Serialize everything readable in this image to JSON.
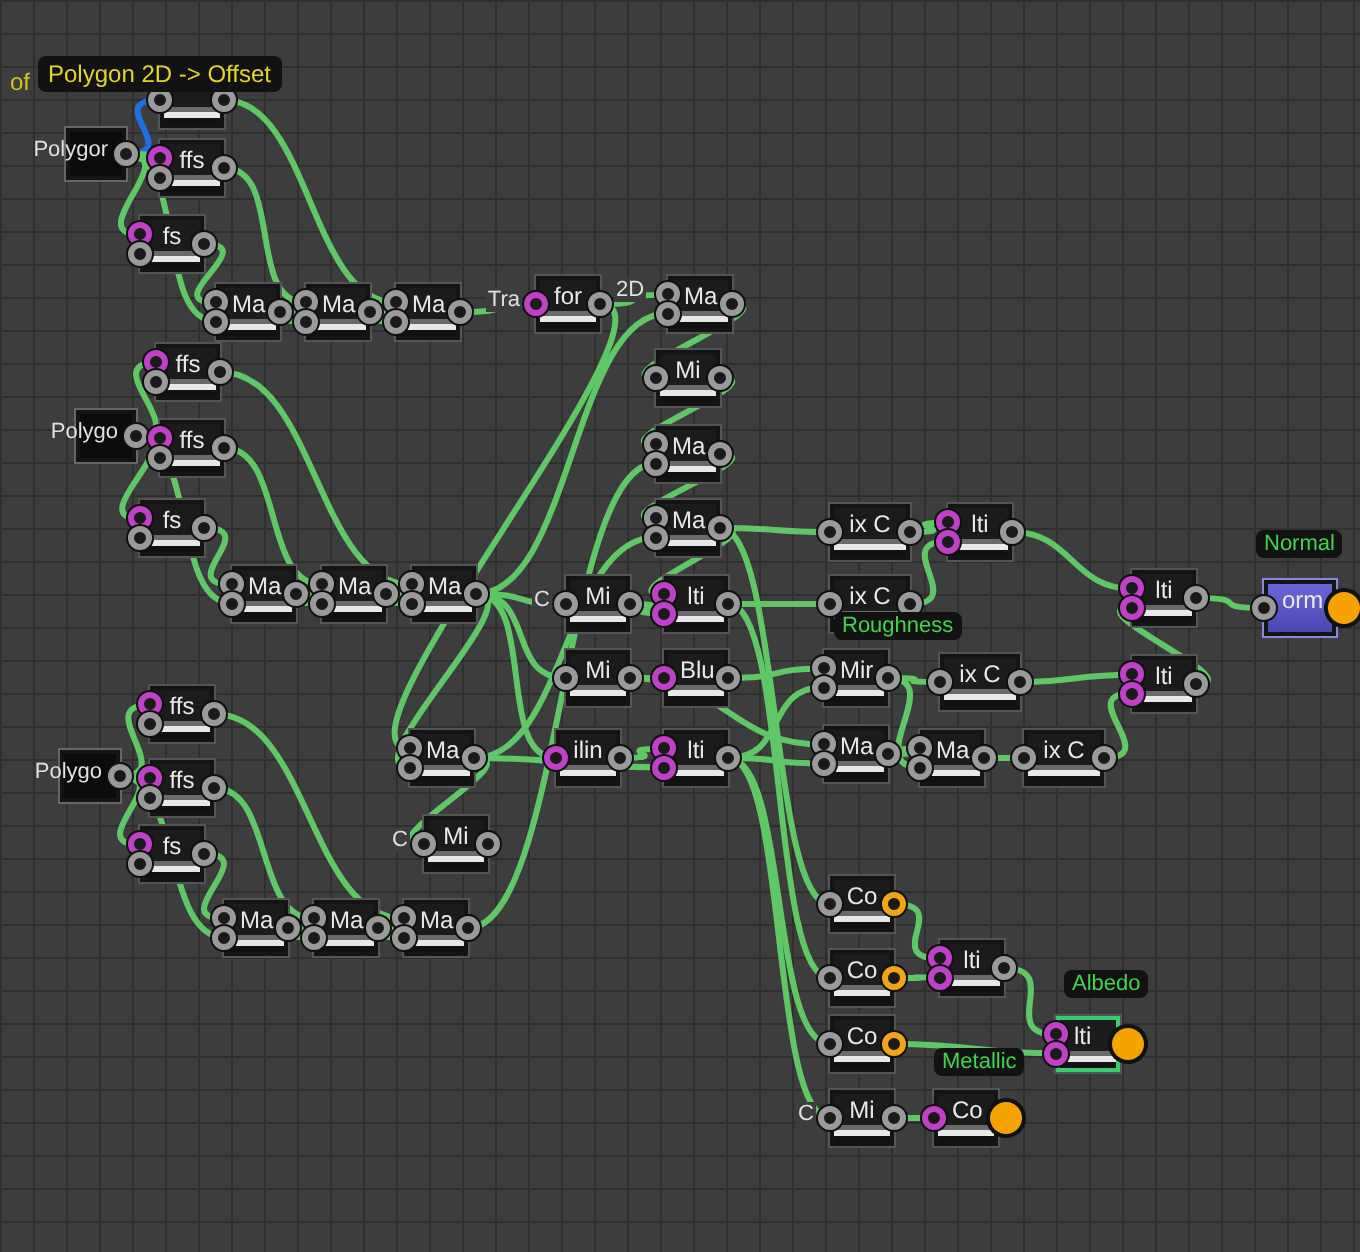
{
  "canvas": {
    "overlay_text": "of",
    "tooltip": "Polygon 2D -> Offset",
    "nodes": [
      {
        "kind": "node",
        "selected": false,
        "inputs": [
          {
            "color": "#9a9a9a"
          }
        ]
      },
      {
        "kind": "source",
        "label": "Polygor",
        "selected": false
      },
      {
        "kind": "node",
        "label": "ffs",
        "selected": false,
        "inputs": [
          {
            "color": "#c040c8"
          },
          {
            "color": "#9a9a9a"
          }
        ]
      },
      {
        "kind": "node",
        "label": "fs",
        "selected": false,
        "inputs": [
          {
            "color": "#c040c8"
          },
          {
            "color": "#9a9a9a"
          }
        ]
      },
      {
        "kind": "node",
        "label": "Ma",
        "selected": false,
        "inputs": [
          {
            "color": "#9a9a9a"
          },
          {
            "color": "#9a9a9a"
          }
        ]
      },
      {
        "kind": "node",
        "label": "Ma",
        "selected": false,
        "inputs": [
          {
            "color": "#9a9a9a"
          },
          {
            "color": "#9a9a9a"
          }
        ]
      },
      {
        "kind": "node",
        "label": "Ma",
        "selected": false,
        "inputs": [
          {
            "color": "#9a9a9a"
          },
          {
            "color": "#9a9a9a"
          }
        ]
      },
      {
        "kind": "node",
        "label": "for",
        "head": "Tra",
        "tail": "2D",
        "selected": false,
        "inputs": [
          {
            "color": "#c040c8"
          }
        ]
      },
      {
        "kind": "node",
        "label": "Ma",
        "selected": false,
        "inputs": [
          {
            "color": "#9a9a9a"
          },
          {
            "color": "#9a9a9a"
          }
        ]
      },
      {
        "kind": "node",
        "label": "Mi",
        "selected": false,
        "inputs": [
          {
            "color": "#9a9a9a"
          }
        ]
      },
      {
        "kind": "node",
        "label": "Ma",
        "selected": false,
        "inputs": [
          {
            "color": "#9a9a9a"
          },
          {
            "color": "#9a9a9a"
          }
        ]
      },
      {
        "kind": "node",
        "label": "Ma",
        "selected": false,
        "inputs": [
          {
            "color": "#9a9a9a"
          },
          {
            "color": "#9a9a9a"
          }
        ]
      },
      {
        "kind": "node",
        "label": "Mi",
        "head": "C",
        "selected": false,
        "inputs": [
          {
            "color": "#9a9a9a"
          }
        ]
      },
      {
        "kind": "node",
        "label": "lti",
        "selected": false,
        "inputs": [
          {
            "color": "#c040c8"
          },
          {
            "color": "#c040c8"
          }
        ]
      },
      {
        "kind": "node",
        "label": "Mi",
        "selected": false,
        "inputs": [
          {
            "color": "#9a9a9a"
          }
        ]
      },
      {
        "kind": "node",
        "label": "Blu",
        "selected": false,
        "inputs": [
          {
            "color": "#c040c8"
          }
        ]
      },
      {
        "kind": "node",
        "label": "ilin",
        "selected": false,
        "inputs": [
          {
            "color": "#c040c8"
          }
        ]
      },
      {
        "kind": "node",
        "label": "lti",
        "selected": false,
        "inputs": [
          {
            "color": "#c040c8"
          },
          {
            "color": "#c040c8"
          }
        ]
      },
      {
        "kind": "source",
        "label": "Polygo",
        "selected": false
      },
      {
        "kind": "node",
        "label": "ffs",
        "selected": false,
        "inputs": [
          {
            "color": "#c040c8"
          },
          {
            "color": "#9a9a9a"
          }
        ]
      },
      {
        "kind": "node",
        "label": "ffs",
        "selected": false,
        "inputs": [
          {
            "color": "#c040c8"
          },
          {
            "color": "#9a9a9a"
          }
        ]
      },
      {
        "kind": "node",
        "label": "fs",
        "selected": false,
        "inputs": [
          {
            "color": "#c040c8"
          },
          {
            "color": "#9a9a9a"
          }
        ]
      },
      {
        "kind": "node",
        "label": "Ma",
        "selected": false,
        "inputs": [
          {
            "color": "#9a9a9a"
          },
          {
            "color": "#9a9a9a"
          }
        ]
      },
      {
        "kind": "node",
        "label": "Ma",
        "selected": false,
        "inputs": [
          {
            "color": "#9a9a9a"
          },
          {
            "color": "#9a9a9a"
          }
        ]
      },
      {
        "kind": "node",
        "label": "Ma",
        "selected": false,
        "inputs": [
          {
            "color": "#9a9a9a"
          },
          {
            "color": "#9a9a9a"
          }
        ]
      },
      {
        "kind": "node",
        "label": "Ma",
        "selected": false,
        "inputs": [
          {
            "color": "#9a9a9a"
          },
          {
            "color": "#9a9a9a"
          }
        ]
      },
      {
        "kind": "node",
        "label": "Mi",
        "head": "C",
        "selected": false,
        "inputs": [
          {
            "color": "#9a9a9a"
          }
        ]
      },
      {
        "kind": "source",
        "label": "Polygo",
        "selected": false
      },
      {
        "kind": "node",
        "label": "ffs",
        "selected": false,
        "inputs": [
          {
            "color": "#c040c8"
          },
          {
            "color": "#9a9a9a"
          }
        ]
      },
      {
        "kind": "node",
        "label": "ffs",
        "selected": false,
        "inputs": [
          {
            "color": "#c040c8"
          },
          {
            "color": "#9a9a9a"
          }
        ]
      },
      {
        "kind": "node",
        "label": "fs",
        "selected": false,
        "inputs": [
          {
            "color": "#c040c8"
          },
          {
            "color": "#9a9a9a"
          }
        ]
      },
      {
        "kind": "node",
        "label": "Ma",
        "selected": false,
        "inputs": [
          {
            "color": "#9a9a9a"
          },
          {
            "color": "#9a9a9a"
          }
        ]
      },
      {
        "kind": "node",
        "label": "Ma",
        "selected": false,
        "inputs": [
          {
            "color": "#9a9a9a"
          },
          {
            "color": "#9a9a9a"
          }
        ]
      },
      {
        "kind": "node",
        "label": "Ma",
        "selected": false,
        "inputs": [
          {
            "color": "#9a9a9a"
          },
          {
            "color": "#9a9a9a"
          }
        ]
      },
      {
        "kind": "node",
        "label": "ix C",
        "selected": false,
        "inputs": [
          {
            "color": "#9a9a9a"
          }
        ]
      },
      {
        "kind": "node",
        "label": "lti",
        "selected": false,
        "inputs": [
          {
            "color": "#c040c8"
          },
          {
            "color": "#c040c8"
          }
        ]
      },
      {
        "kind": "node",
        "label": "ix C",
        "tag": "Roughness",
        "selected": false,
        "inputs": [
          {
            "color": "#9a9a9a"
          }
        ]
      },
      {
        "kind": "node",
        "label": "Mir",
        "selected": false,
        "inputs": [
          {
            "color": "#9a9a9a"
          },
          {
            "color": "#9a9a9a"
          }
        ]
      },
      {
        "kind": "node",
        "label": "ix C",
        "selected": false,
        "inputs": [
          {
            "color": "#9a9a9a"
          }
        ]
      },
      {
        "kind": "node",
        "label": "Ma",
        "selected": false,
        "inputs": [
          {
            "color": "#9a9a9a"
          },
          {
            "color": "#9a9a9a"
          }
        ]
      },
      {
        "kind": "node",
        "label": "Ma",
        "selected": false,
        "inputs": [
          {
            "color": "#9a9a9a"
          },
          {
            "color": "#9a9a9a"
          }
        ]
      },
      {
        "kind": "node",
        "label": "ix C",
        "selected": false,
        "inputs": [
          {
            "color": "#9a9a9a"
          }
        ]
      },
      {
        "kind": "node",
        "label": "lti",
        "selected": false,
        "inputs": [
          {
            "color": "#c040c8"
          },
          {
            "color": "#c040c8"
          }
        ]
      },
      {
        "kind": "node",
        "label": "lti",
        "selected": false,
        "inputs": [
          {
            "color": "#c040c8"
          },
          {
            "color": "#c040c8"
          }
        ]
      },
      {
        "kind": "normal-output",
        "label": "orm",
        "tag": "Normal",
        "selected": false,
        "inputs": [
          {
            "color": "#9a9a9a"
          }
        ]
      },
      {
        "kind": "color-node",
        "label": "Co",
        "selected": false,
        "inputs": [
          {
            "color": "#9a9a9a"
          }
        ]
      },
      {
        "kind": "color-node",
        "label": "Co",
        "selected": false,
        "inputs": [
          {
            "color": "#9a9a9a"
          }
        ]
      },
      {
        "kind": "node",
        "label": "lti",
        "selected": false,
        "inputs": [
          {
            "color": "#c040c8"
          },
          {
            "color": "#c040c8"
          }
        ]
      },
      {
        "kind": "color-node",
        "label": "Co",
        "tag": "Metallic",
        "selected": false,
        "inputs": [
          {
            "color": "#9a9a9a"
          }
        ]
      },
      {
        "kind": "output",
        "label": "lti",
        "tag": "Albedo",
        "selected": true,
        "inputs": [
          {
            "color": "#c040c8"
          },
          {
            "color": "#c040c8"
          }
        ]
      },
      {
        "kind": "node",
        "label": "Mi",
        "head": "C",
        "selected": false,
        "inputs": [
          {
            "color": "#9a9a9a"
          }
        ]
      },
      {
        "kind": "output",
        "label": "Co",
        "selected": false,
        "inputs": [
          {
            "color": "#c040c8"
          }
        ]
      }
    ]
  }
}
